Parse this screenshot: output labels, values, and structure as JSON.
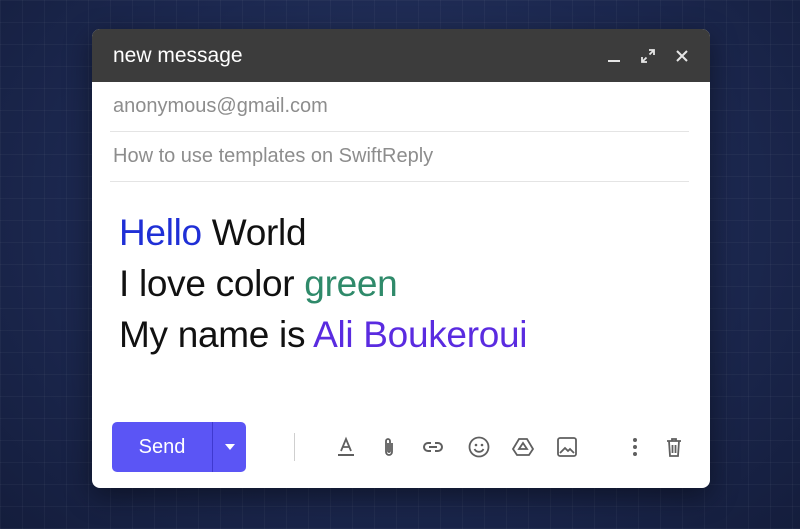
{
  "window": {
    "title": "new message"
  },
  "compose": {
    "to": "anonymous@gmail.com",
    "subject": "How to use templates on SwiftReply",
    "lines": [
      {
        "parts": [
          {
            "text": "Hello",
            "color": "#1f2fd6"
          },
          {
            "text": " World",
            "color": "#111111"
          }
        ]
      },
      {
        "parts": [
          {
            "text": "I love color ",
            "color": "#111111"
          },
          {
            "text": "green",
            "color": "#2f8a6a"
          }
        ]
      },
      {
        "parts": [
          {
            "text": "My name is ",
            "color": "#111111"
          },
          {
            "text": "Ali Boukeroui",
            "color": "#5a2be0"
          }
        ]
      }
    ]
  },
  "toolbar": {
    "send_label": "Send",
    "send_color": "#5b55f5",
    "icons": [
      "text-format-icon",
      "paperclip-icon",
      "link-icon",
      "emoji-icon",
      "drive-icon",
      "image-icon",
      "more-vertical-icon",
      "trash-icon"
    ]
  }
}
